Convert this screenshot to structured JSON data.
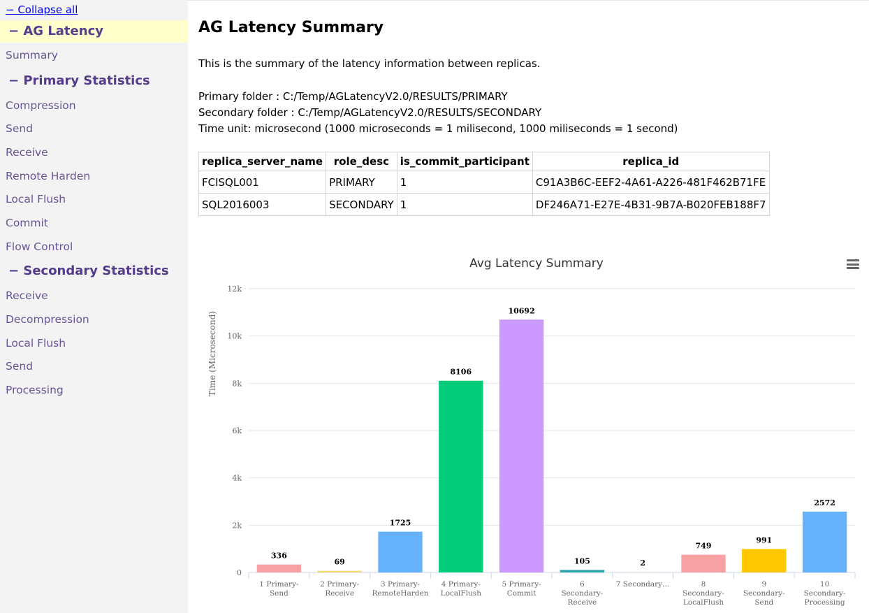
{
  "sidebar": {
    "collapse_label": "− Collapse all",
    "groups": [
      {
        "title": "− AG Latency",
        "items": [
          "Summary"
        ]
      },
      {
        "title": "− Primary Statistics",
        "items": [
          "Compression",
          "Send",
          "Receive",
          "Remote Harden",
          "Local Flush",
          "Commit",
          "Flow Control"
        ]
      },
      {
        "title": "− Secondary Statistics",
        "items": [
          "Receive",
          "Decompression",
          "Local Flush",
          "Send",
          "Processing"
        ]
      }
    ]
  },
  "main": {
    "title": "AG Latency Summary",
    "description": "This is the summary of the latency information between replicas.",
    "primary_folder": "Primary folder : C:/Temp/AGLatencyV2.0/RESULTS/PRIMARY",
    "secondary_folder": "Secondary folder : C:/Temp/AGLatencyV2.0/RESULTS/SECONDARY",
    "time_unit": "Time unit: microsecond (1000 microseconds = 1 milisecond, 1000 miliseconds = 1 second)",
    "table": {
      "headers": [
        "replica_server_name",
        "role_desc",
        "is_commit_participant",
        "replica_id"
      ],
      "rows": [
        [
          "FCISQL001",
          "PRIMARY",
          "1",
          "C91A3B6C-EEF2-4A61-A226-481F462B71FE"
        ],
        [
          "SQL2016003",
          "SECONDARY",
          "1",
          "DF246A71-E27E-4B31-9B7A-B020FEB188F7"
        ]
      ]
    }
  },
  "colors": {
    "accent_purple": "#553b8b",
    "active_highlight": "#ffffcc",
    "link_blue": "#0000ee"
  },
  "chart_data": {
    "type": "bar",
    "title": "Avg Latency Summary",
    "ylabel": "Time (Microsecond)",
    "xlabel": "",
    "ylim": [
      0,
      12000
    ],
    "yticks": [
      0,
      2000,
      4000,
      6000,
      8000,
      10000,
      12000
    ],
    "ytick_labels": [
      "0",
      "2k",
      "4k",
      "6k",
      "8k",
      "10k",
      "12k"
    ],
    "grid": true,
    "legend": "none",
    "categories": [
      [
        "1 Primary-",
        "Send"
      ],
      [
        "2 Primary-",
        "Receive"
      ],
      [
        "3 Primary-",
        "RemoteHarden"
      ],
      [
        "4 Primary-",
        "LocalFlush"
      ],
      [
        "5 Primary-",
        "Commit"
      ],
      [
        "6",
        "Secondary-",
        "Receive"
      ],
      [
        "7 Secondary…"
      ],
      [
        "8",
        "Secondary-",
        "LocalFlush"
      ],
      [
        "9",
        "Secondary-",
        "Send"
      ],
      [
        "10",
        "Secondary-",
        "Processing"
      ]
    ],
    "values": [
      336,
      69,
      1725,
      8106,
      10692,
      105,
      2,
      749,
      991,
      2572
    ],
    "data_labels": [
      "336",
      "69",
      "1725",
      "8106",
      "10692",
      "105",
      "2",
      "749",
      "991",
      "2572"
    ],
    "colors": [
      "#f7a1a4",
      "#f2d96b",
      "#67b3fb",
      "#00cc79",
      "#cc99ff",
      "#2ba3aa",
      "#e6e6e6",
      "#f7a1a4",
      "#ffc800",
      "#67b3fb"
    ]
  }
}
